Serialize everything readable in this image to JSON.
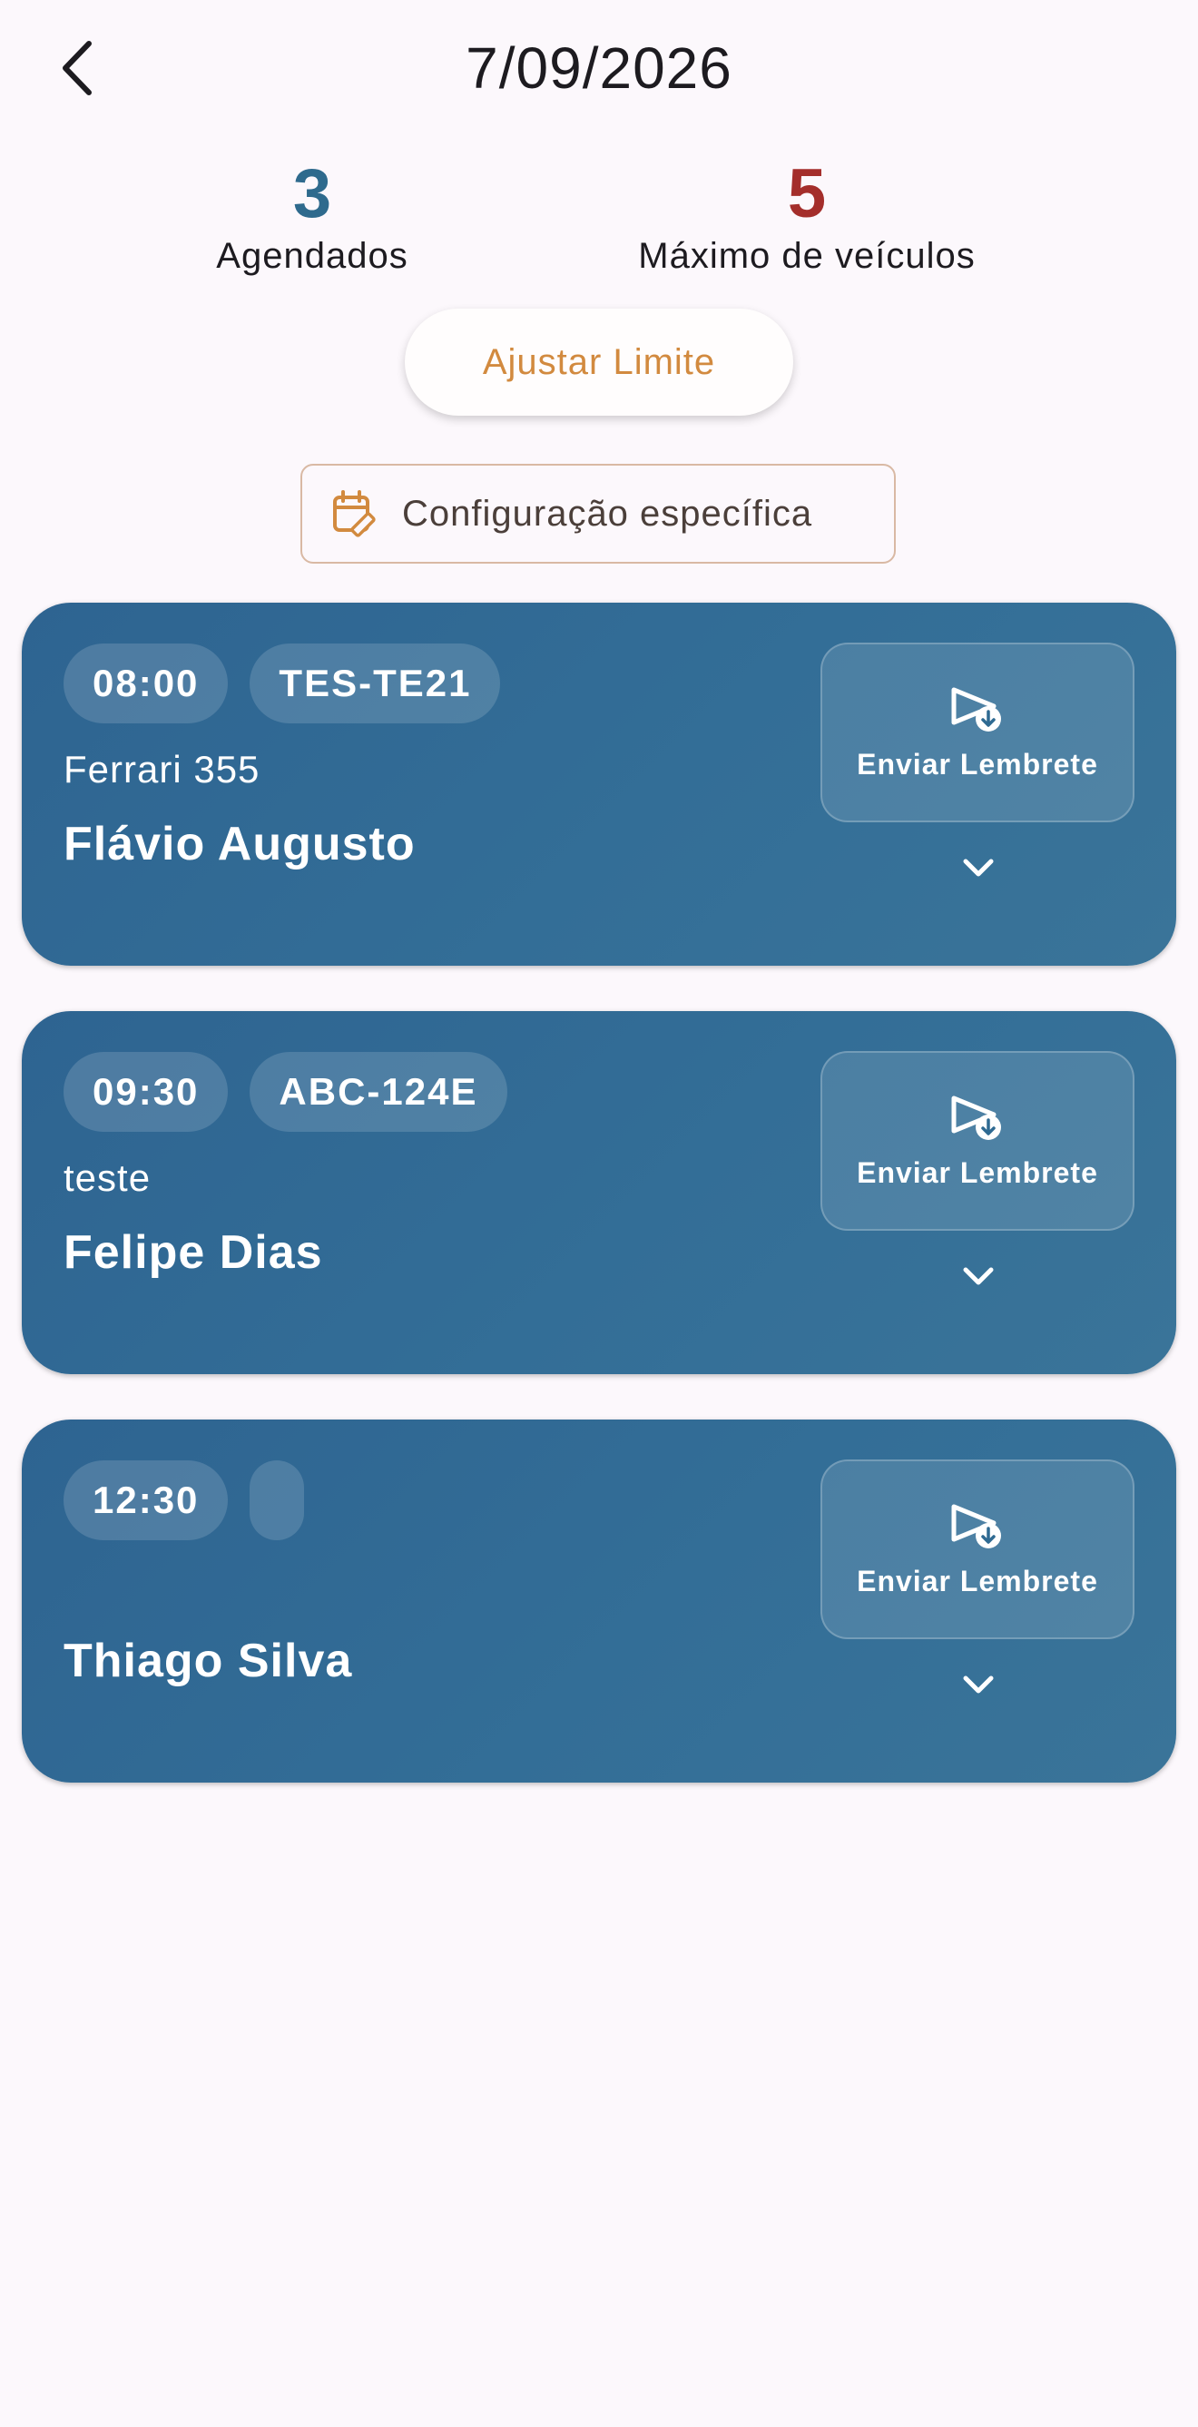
{
  "header": {
    "title": "7/09/2026",
    "back_icon": "chevron-left-icon"
  },
  "stats": {
    "scheduled": {
      "value": "3",
      "label": "Agendados",
      "color": "#2e6a8d"
    },
    "max": {
      "value": "5",
      "label": "Máximo de veículos",
      "color": "#a42e2b"
    }
  },
  "actions": {
    "adjust_label": "Ajustar Limite",
    "config_label": "Configuração específica",
    "config_icon": "calendar-edit-icon"
  },
  "appointments": [
    {
      "time": "08:00",
      "plate": "TES-TE21",
      "car": "Ferrari 355",
      "client": "Flávio Augusto",
      "remind_label": "Enviar Lembrete"
    },
    {
      "time": "09:30",
      "plate": "ABC-124E",
      "car": "teste",
      "client": "Felipe Dias",
      "remind_label": "Enviar Lembrete"
    },
    {
      "time": "12:30",
      "plate": "",
      "car": "",
      "client": "Thiago Silva",
      "remind_label": "Enviar Lembrete"
    }
  ],
  "colors": {
    "card_background": "#2e6491",
    "accent_orange": "#d28a3f",
    "background": "#fcf8fc"
  }
}
